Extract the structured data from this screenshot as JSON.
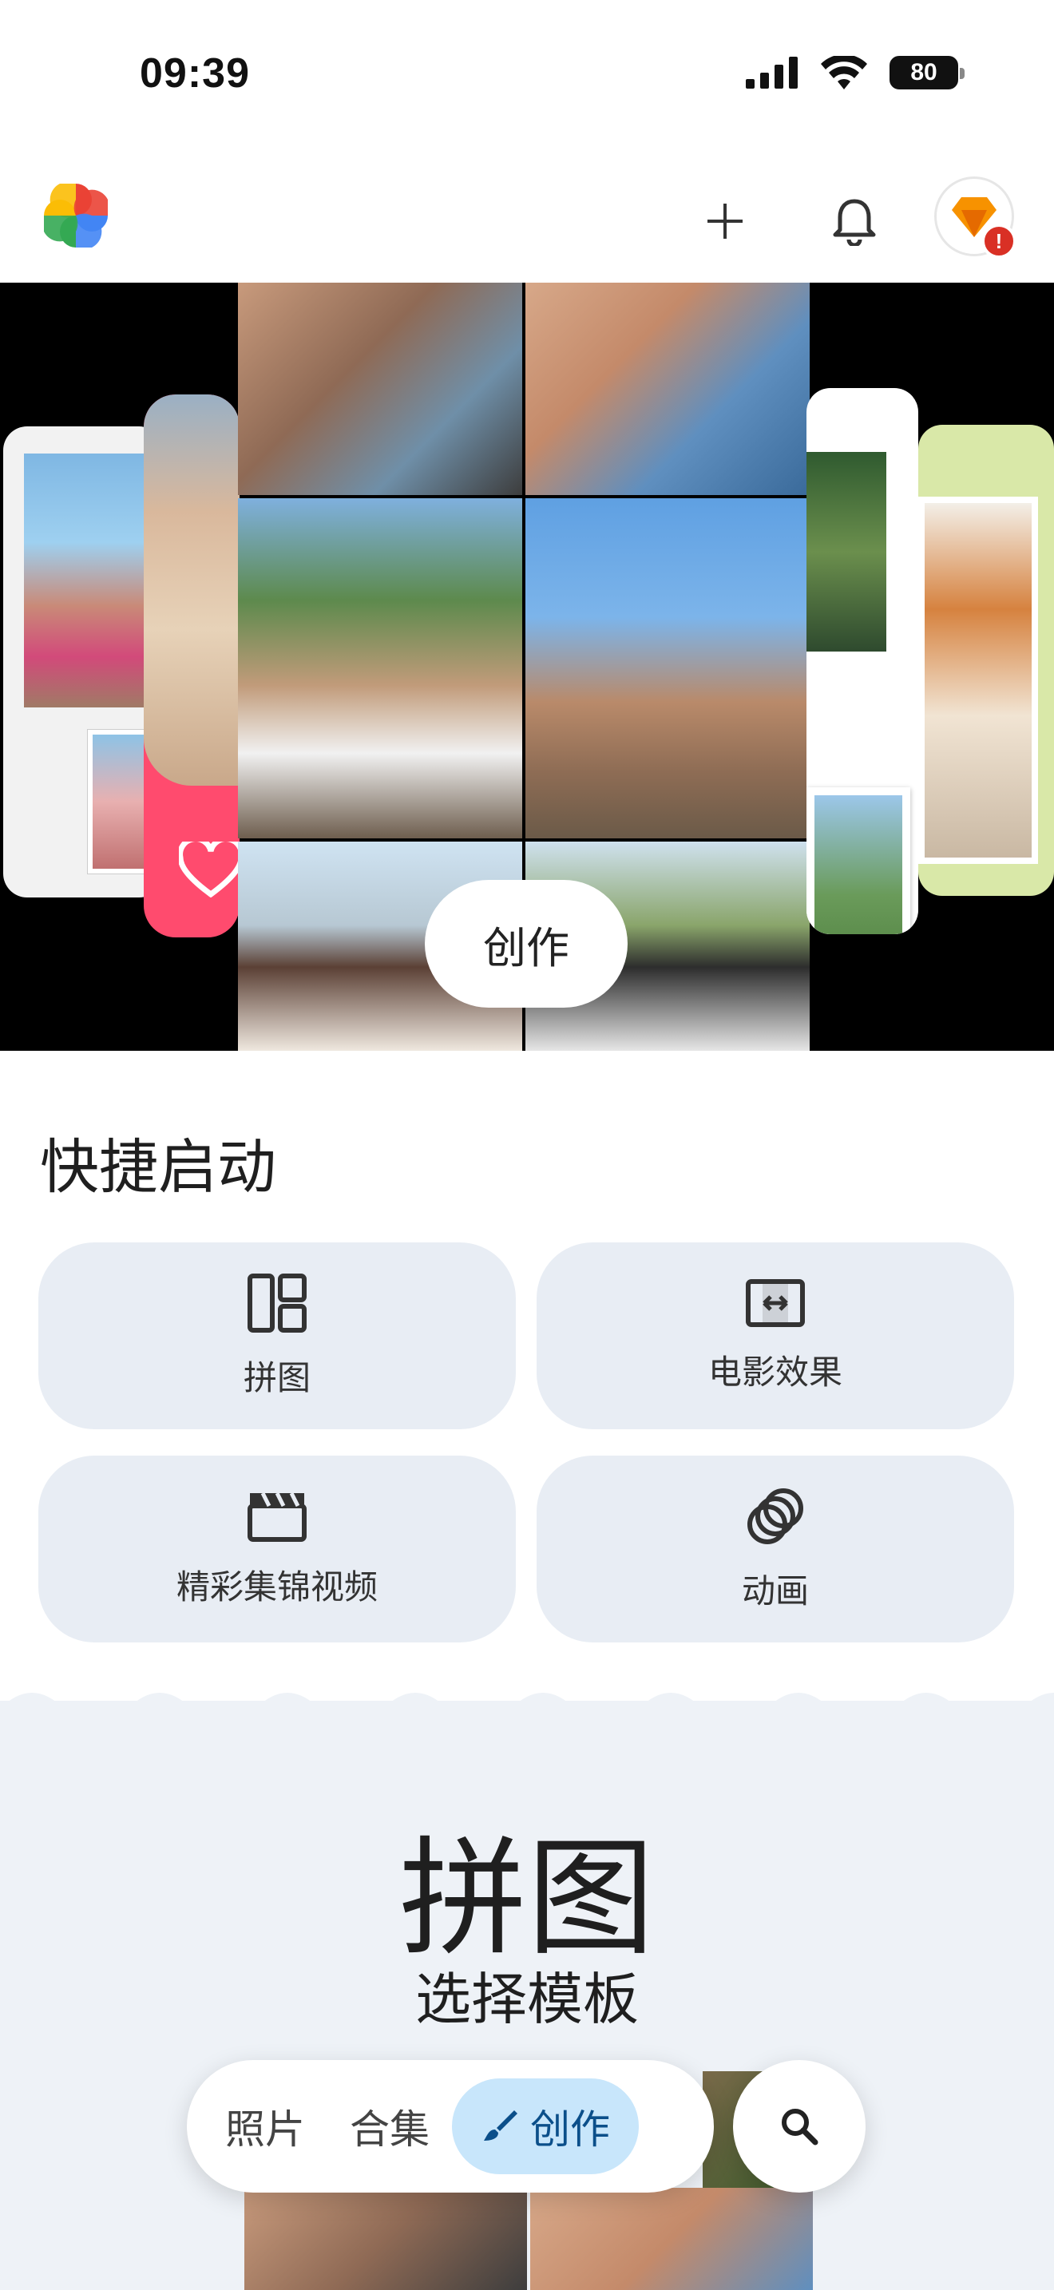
{
  "status_bar": {
    "time": "09:39",
    "battery": "80",
    "icons": [
      "signal-icon",
      "wifi-icon",
      "battery-icon"
    ]
  },
  "header": {
    "logo": "google-photos-logo",
    "actions": [
      "add-icon",
      "bell-icon",
      "avatar"
    ]
  },
  "hero": {
    "button_label": "创作"
  },
  "quick_start": {
    "title": "快捷启动",
    "items": [
      {
        "label": "拼图",
        "icon": "collage-icon"
      },
      {
        "label": "电影效果",
        "icon": "cinematic-icon"
      },
      {
        "label": "精彩集锦视频",
        "icon": "clapperboard-icon"
      },
      {
        "label": "动画",
        "icon": "animation-icon"
      }
    ]
  },
  "promo": {
    "title": "拼图",
    "subtitle": "选择模板"
  },
  "bottom_nav": {
    "tabs": [
      {
        "label": "照片",
        "active": false
      },
      {
        "label": "合集",
        "active": false
      },
      {
        "label": "创作",
        "active": true
      }
    ],
    "search_icon": "search-icon"
  },
  "colors": {
    "card_bg": "#e8edf4",
    "active_tab_bg": "#c8e6fb",
    "active_tab_text": "#0b4f8a",
    "alert": "#d93025"
  }
}
